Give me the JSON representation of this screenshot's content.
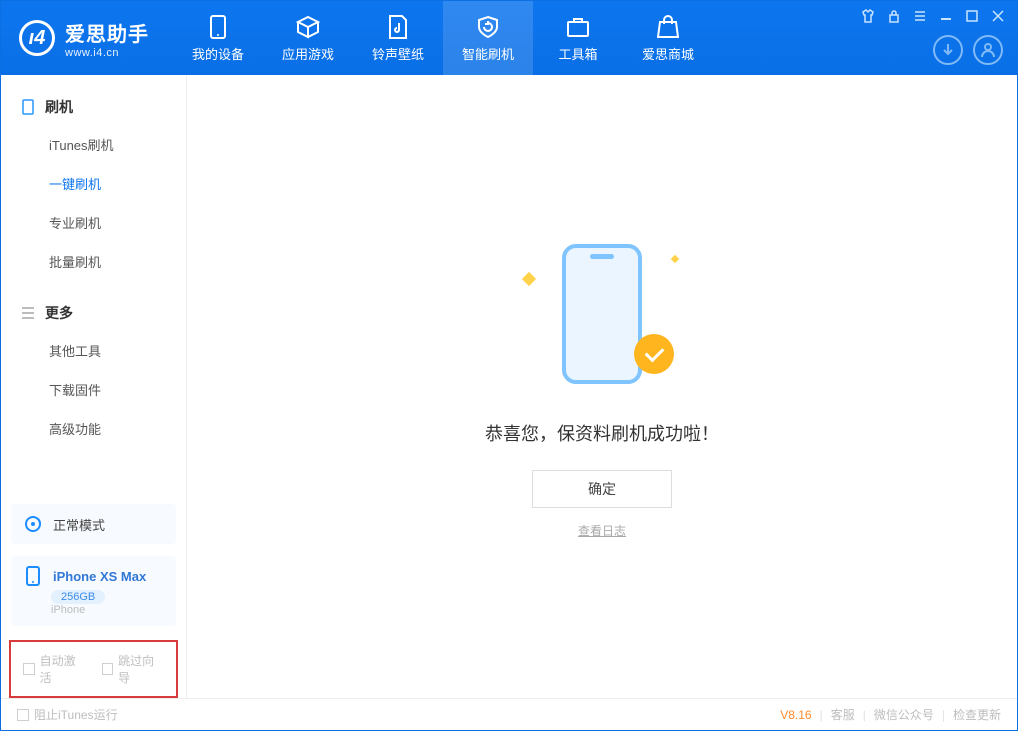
{
  "logo": {
    "cn": "爱思助手",
    "url": "www.i4.cn"
  },
  "tabs": [
    {
      "label": "我的设备"
    },
    {
      "label": "应用游戏"
    },
    {
      "label": "铃声壁纸"
    },
    {
      "label": "智能刷机"
    },
    {
      "label": "工具箱"
    },
    {
      "label": "爱思商城"
    }
  ],
  "sidebar": {
    "group1": {
      "title": "刷机",
      "items": [
        "iTunes刷机",
        "一键刷机",
        "专业刷机",
        "批量刷机"
      ]
    },
    "group2": {
      "title": "更多",
      "items": [
        "其他工具",
        "下载固件",
        "高级功能"
      ]
    }
  },
  "mode_card": "正常模式",
  "device": {
    "name": "iPhone XS Max",
    "storage": "256GB",
    "type": "iPhone"
  },
  "options": {
    "auto_activate": "自动激活",
    "skip_guide": "跳过向导"
  },
  "main": {
    "message": "恭喜您，保资料刷机成功啦！",
    "ok": "确定",
    "log": "查看日志"
  },
  "statusbar": {
    "prevent_itunes": "阻止iTunes运行",
    "version": "V8.16",
    "service": "客服",
    "wechat": "微信公众号",
    "update": "检查更新"
  }
}
